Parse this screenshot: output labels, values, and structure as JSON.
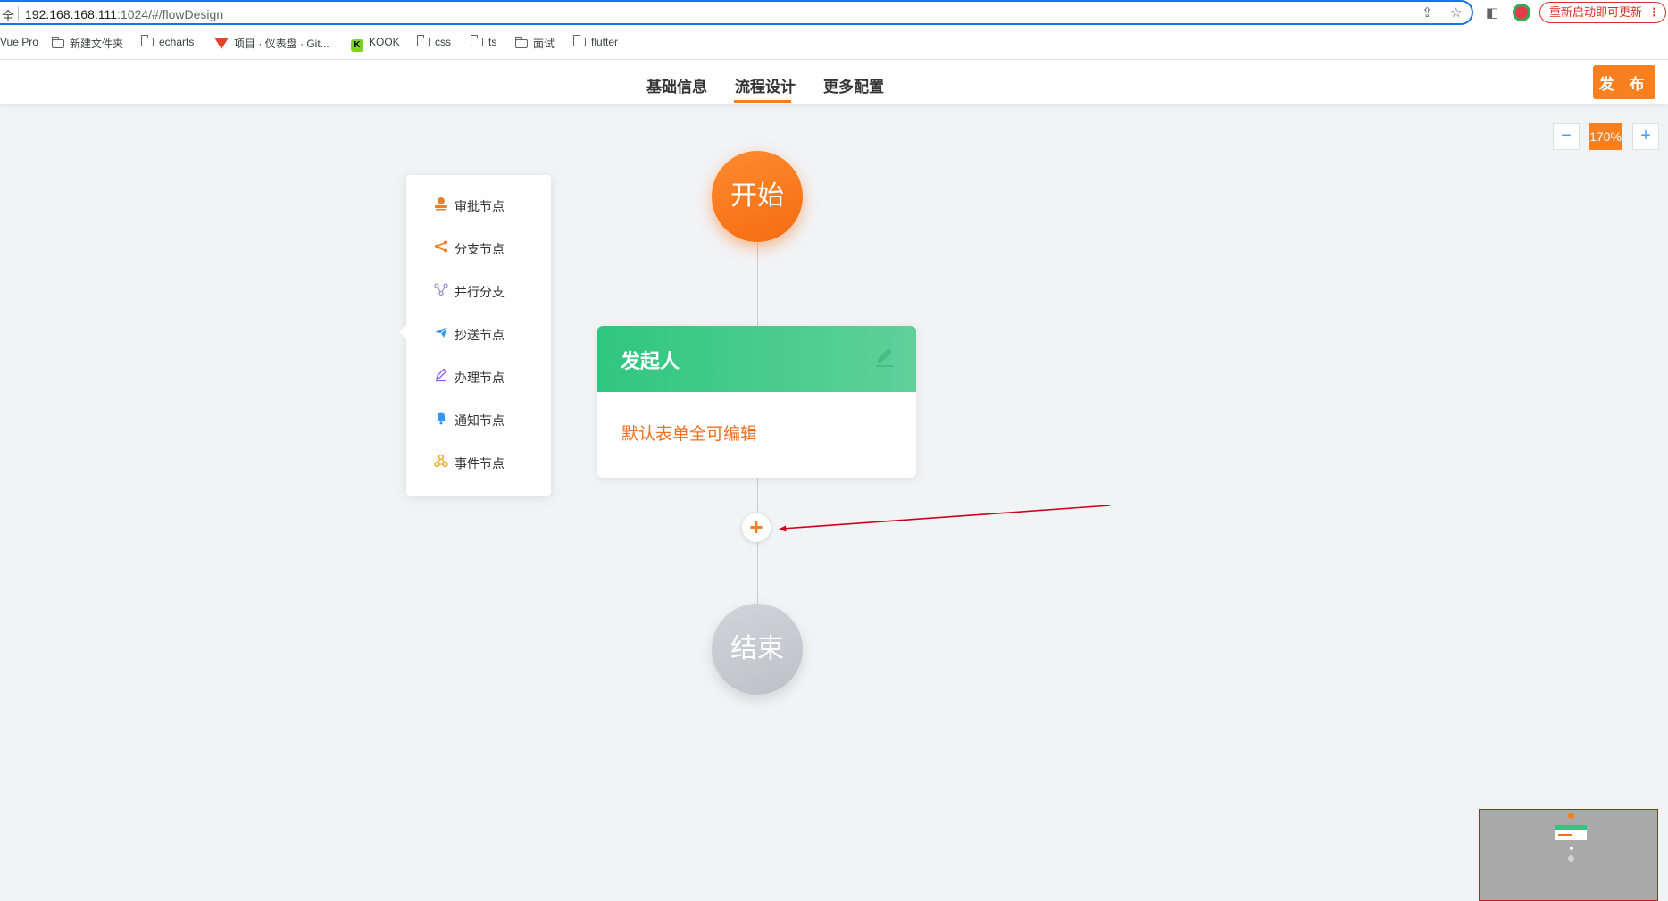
{
  "browser": {
    "security_text": "全",
    "url_host": "192.168.168.111",
    "url_path": ":1024/#/flowDesign",
    "update_label": "重新启动即可更新",
    "bookmarks": [
      {
        "label": "Vue Pro",
        "icon": "none"
      },
      {
        "label": "新建文件夹",
        "icon": "folder-icon"
      },
      {
        "label": "echarts",
        "icon": "folder-icon"
      },
      {
        "label": "项目 · 仪表盘 · Git...",
        "icon": "gitlab-icon"
      },
      {
        "label": "KOOK",
        "icon": "kook-icon"
      },
      {
        "label": "css",
        "icon": "folder-icon"
      },
      {
        "label": "ts",
        "icon": "folder-icon"
      },
      {
        "label": "面试",
        "icon": "folder-icon"
      },
      {
        "label": "flutter",
        "icon": "folder-icon"
      }
    ]
  },
  "header": {
    "tabs": [
      {
        "label": "基础信息",
        "active": false
      },
      {
        "label": "流程设计",
        "active": true
      },
      {
        "label": "更多配置",
        "active": false
      }
    ],
    "publish_label": "发 布",
    "accent_color": "#fa7f1e"
  },
  "zoom": {
    "minus": "−",
    "value": "170%",
    "plus": "+"
  },
  "node_menu": {
    "items": [
      {
        "label": "审批节点",
        "icon": "approver-icon",
        "color": "#f57c1f"
      },
      {
        "label": "分支节点",
        "icon": "branch-icon",
        "color": "#f57c1f"
      },
      {
        "label": "并行分支",
        "icon": "parallel-icon",
        "color": "#9a8fd8"
      },
      {
        "label": "抄送节点",
        "icon": "send-icon",
        "color": "#3296fa"
      },
      {
        "label": "办理节点",
        "icon": "edit-icon",
        "color": "#8e5cf7"
      },
      {
        "label": "通知节点",
        "icon": "bell-icon",
        "color": "#3296fa"
      },
      {
        "label": "事件节点",
        "icon": "event-icon",
        "color": "#f5a623"
      }
    ]
  },
  "flow": {
    "start_label": "开始",
    "initiator": {
      "title": "发起人",
      "content": "默认表单全可编辑",
      "header_color": "#2fc77f"
    },
    "add_symbol": "+",
    "end_label": "结束"
  }
}
